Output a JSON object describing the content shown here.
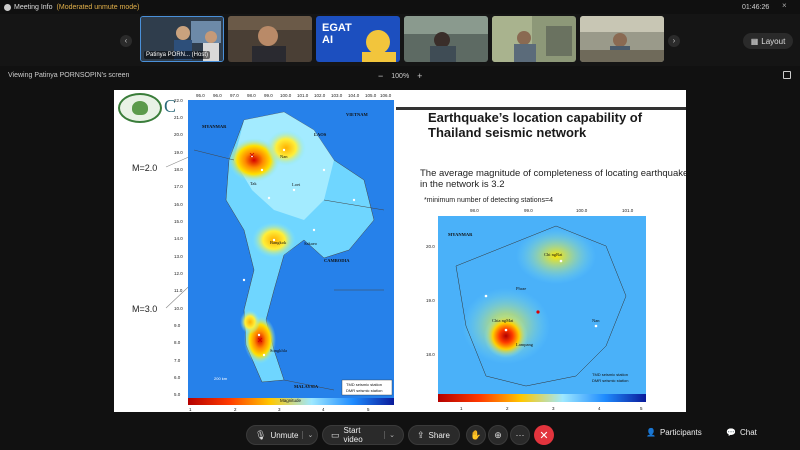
{
  "window": {
    "title": "Meeting Info",
    "mode": "(Moderated unmute mode)",
    "time": "01:46:26",
    "minimize": "–",
    "close": "×"
  },
  "participants_strip": {
    "prev": "‹",
    "next": "›",
    "tiles": [
      {
        "label": "Patinya PORN...  (Host)",
        "bg": "#3b4a5a"
      },
      {
        "label": "",
        "bg": "#4a3f35"
      },
      {
        "label": "",
        "bg": "#1c4fbf"
      },
      {
        "label": "",
        "bg": "#5d6a63"
      },
      {
        "label": "",
        "bg": "#6e7462"
      },
      {
        "label": "",
        "bg": "#8a8a7a"
      }
    ],
    "tile3_text": "EGAT AI"
  },
  "layout_button": "Layout",
  "viewing": "Viewing Patinya PORNSOPIN's screen",
  "zoom": {
    "minus": "−",
    "value": "100%",
    "plus": "+"
  },
  "slide": {
    "title": "Earthquake’s location capability of Thailand seismic network",
    "body": "The average magnitude of completeness of locating earthquake in the network is 3.2",
    "note": "*minimum number of detecting stations=4",
    "m_high": "M=2.0",
    "m_low": "M=3.0",
    "big_map": {
      "lat_ticks": [
        "22.0",
        "21.0",
        "20.0",
        "19.0",
        "18.0",
        "17.0",
        "16.0",
        "15.0",
        "14.0",
        "13.0",
        "12.0",
        "11.0",
        "10.0",
        "9.0",
        "8.0",
        "7.0",
        "6.0",
        "5.0"
      ],
      "lon_ticks": [
        "95.0",
        "96.0",
        "97.0",
        "98.0",
        "99.0",
        "100.0",
        "101.0",
        "102.0",
        "103.0",
        "104.0",
        "105.0",
        "106.0"
      ],
      "countries": [
        "MYANMAR",
        "LAOS",
        "VIETNAM",
        "CAMBODIA",
        "MALAYSIA"
      ],
      "places": [
        "Nan",
        "Tak",
        "Loei",
        "Bangkok",
        "Sakaeo",
        "Songkhla"
      ],
      "legend": [
        "TMD seismic station",
        "DMR seismic station"
      ],
      "colorbar": [
        "1",
        "2",
        "3",
        "4",
        "5"
      ],
      "colorbar_label": "Magnitude",
      "scale": "200 km"
    },
    "small_map": {
      "lat_ticks": [
        "20.0",
        "19.0",
        "18.0"
      ],
      "lon_ticks": [
        "98.0",
        "99.0",
        "100.0",
        "101.0"
      ],
      "places": [
        "MYANMAR",
        "Chi ngRai",
        "Phrae",
        "Chia ngMai",
        "Lampang",
        "Nan"
      ],
      "legend": [
        "TMD seismic station",
        "DMR seismic station"
      ],
      "colorbar": [
        "1",
        "2",
        "3",
        "4",
        "5"
      ]
    }
  },
  "controls": {
    "unmute": "Unmute",
    "start_video": "Start video",
    "share": "Share",
    "participants": "Participants",
    "chat": "Chat",
    "more": "···"
  }
}
